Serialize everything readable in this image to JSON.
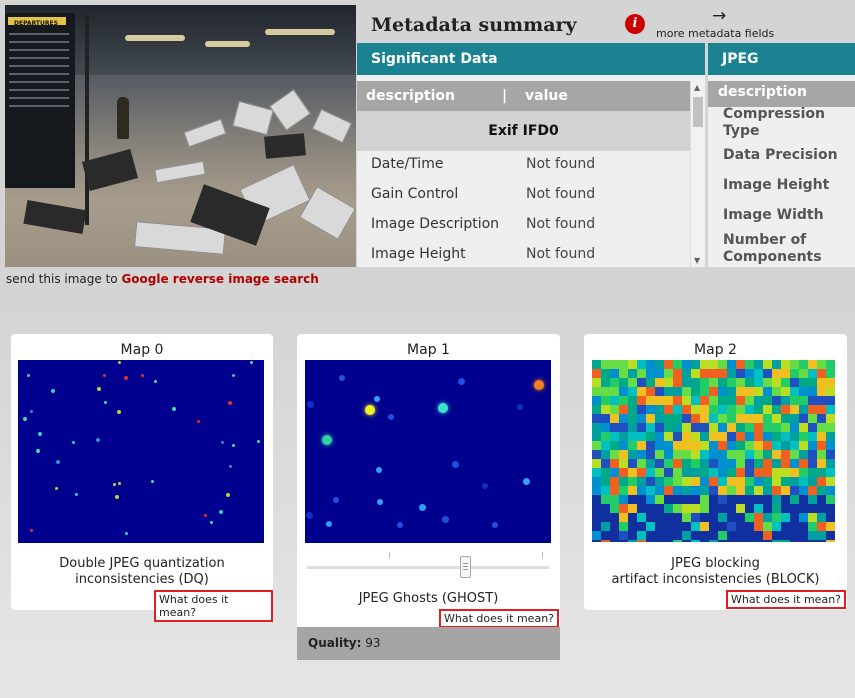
{
  "metadata": {
    "title": "Metadata summary",
    "more_fields_label": "more metadata fields",
    "info_icon": "info-icon",
    "arrow_icon": "arrow-right-icon",
    "significant": {
      "header": "Significant Data",
      "col_description": "description",
      "col_separator": "|",
      "col_value": "value",
      "group": "Exif IFD0",
      "rows": [
        {
          "key": "Date/Time",
          "value": "Not found"
        },
        {
          "key": "Gain Control",
          "value": "Not found"
        },
        {
          "key": "Image Description",
          "value": "Not found"
        },
        {
          "key": "Image Height",
          "value": "Not found"
        }
      ]
    },
    "jpeg": {
      "header": "JPEG",
      "col_description": "description",
      "items": [
        "Compression Type",
        "Data Precision",
        "Image Height",
        "Image Width",
        "Number of Components"
      ]
    }
  },
  "send": {
    "prefix": "send this image to",
    "link": "Google reverse image search"
  },
  "maps": [
    {
      "title": "Map 0",
      "caption_line1": "Double JPEG quantization",
      "caption_line2": "inconsistencies (DQ)",
      "help": "What does it mean?"
    },
    {
      "title": "Map 1",
      "caption_line1": "JPEG Ghosts (GHOST)",
      "caption_line2": "",
      "help": "What does it mean?",
      "quality_label": "Quality:",
      "quality_value": "93"
    },
    {
      "title": "Map 2",
      "caption_line1": "JPEG blocking",
      "caption_line2": "artifact inconsistencies (BLOCK)",
      "help": "What does it mean?"
    }
  ],
  "colors": {
    "teal_header": "#1b8291",
    "link_red": "#b00000",
    "help_border": "#e02020",
    "map_background": "#00008e"
  }
}
